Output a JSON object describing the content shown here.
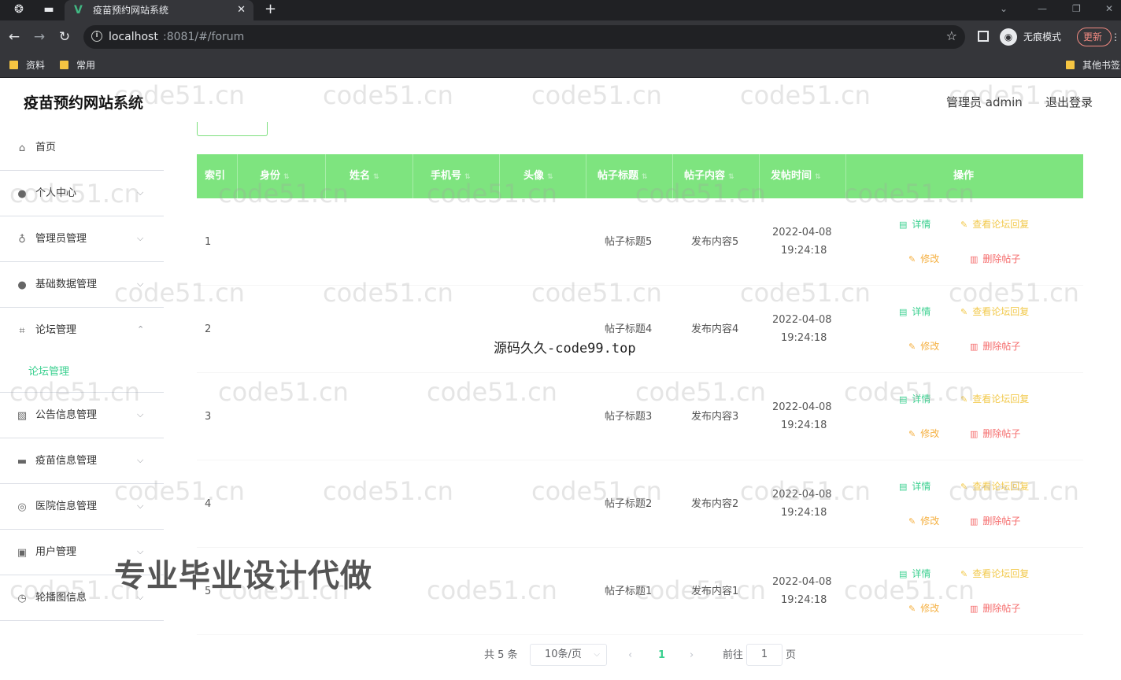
{
  "browser": {
    "tab_title": "疫苗预约网站系统",
    "url_host": "localhost",
    "url_path": ":8081/#/forum",
    "incognito_label": "无痕模式",
    "update_label": "更新",
    "bookmarks": [
      "资料",
      "常用"
    ],
    "other_bookmarks": "其他书签"
  },
  "app": {
    "title": "疫苗预约网站系统",
    "admin_label": "管理员 admin",
    "logout_label": "退出登录"
  },
  "sidebar": {
    "items": [
      {
        "label": "首页",
        "icon": "home-icon"
      },
      {
        "label": "个人中心",
        "icon": "user-icon"
      },
      {
        "label": "管理员管理",
        "icon": "mic-icon"
      },
      {
        "label": "基础数据管理",
        "icon": "user-icon"
      },
      {
        "label": "论坛管理",
        "icon": "crop-icon"
      },
      {
        "label": "公告信息管理",
        "icon": "chart-icon"
      },
      {
        "label": "疫苗信息管理",
        "icon": "monitor-icon"
      },
      {
        "label": "医院信息管理",
        "icon": "globe-icon"
      },
      {
        "label": "用户管理",
        "icon": "clipboard-icon"
      },
      {
        "label": "轮播图信息",
        "icon": "compass-icon"
      }
    ],
    "active_sub": "论坛管理"
  },
  "table": {
    "columns": [
      "索引",
      "身份",
      "姓名",
      "手机号",
      "头像",
      "帖子标题",
      "帖子内容",
      "发帖时间",
      "操作"
    ],
    "rows": [
      {
        "index": "1",
        "title": "帖子标题5",
        "content": "发布内容5",
        "date": "2022-04-08",
        "time": "19:24:18"
      },
      {
        "index": "2",
        "title": "帖子标题4",
        "content": "发布内容4",
        "date": "2022-04-08",
        "time": "19:24:18"
      },
      {
        "index": "3",
        "title": "帖子标题3",
        "content": "发布内容3",
        "date": "2022-04-08",
        "time": "19:24:18"
      },
      {
        "index": "4",
        "title": "帖子标题2",
        "content": "发布内容2",
        "date": "2022-04-08",
        "time": "19:24:18"
      },
      {
        "index": "5",
        "title": "帖子标题1",
        "content": "发布内容1",
        "date": "2022-04-08",
        "time": "19:24:18"
      }
    ],
    "actions": {
      "detail": "详情",
      "view_replies": "查看论坛回复",
      "edit": "修改",
      "delete": "删除帖子"
    }
  },
  "pagination": {
    "total": "共 5 条",
    "page_size": "10条/页",
    "current_page": "1",
    "goto_label": "前往",
    "goto_value": "1",
    "page_unit": "页"
  },
  "overlays": {
    "watermark": "code51.cn",
    "source_text": "源码久久-code99.top",
    "promo_text": "专业毕业设计代做"
  },
  "colors": {
    "header_green": "#7ee47f",
    "accent_green": "#3ad08f",
    "danger": "#f56c6c",
    "warning": "#f5b041"
  }
}
